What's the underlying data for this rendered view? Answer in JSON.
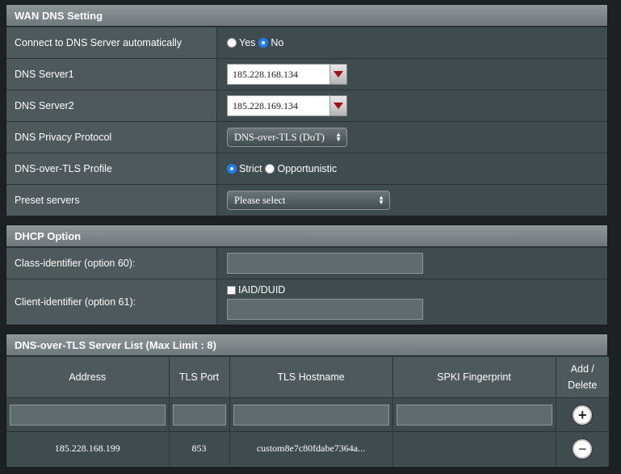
{
  "wan_dns": {
    "title": "WAN DNS Setting",
    "auto_label": "Connect to DNS Server automatically",
    "auto_options": [
      "Yes",
      "No"
    ],
    "auto_selected": "No",
    "dns1_label": "DNS Server1",
    "dns1_value": "185.228.168.134",
    "dns2_label": "DNS Server2",
    "dns2_value": "185.228.169.134",
    "privacy_label": "DNS Privacy Protocol",
    "privacy_value": "DNS-over-TLS (DoT)",
    "profile_label": "DNS-over-TLS Profile",
    "profile_options": [
      "Strict",
      "Opportunistic"
    ],
    "profile_selected": "Strict",
    "preset_label": "Preset servers",
    "preset_value": "Please select"
  },
  "dhcp": {
    "title": "DHCP Option",
    "class_label": "Class-identifier (option 60):",
    "class_value": "",
    "client_label": "Client-identifier (option 61):",
    "iaid_label": "IAID/DUID",
    "client_value": ""
  },
  "dot_list": {
    "title": "DNS-over-TLS Server List (Max Limit : 8)",
    "columns": [
      "Address",
      "TLS Port",
      "TLS Hostname",
      "SPKI Fingerprint",
      "Add / Delete"
    ],
    "rows": [
      {
        "address": "185.228.168.199",
        "port": "853",
        "hostname": "custom8e7c80fdabe7364a...",
        "fingerprint": ""
      }
    ]
  },
  "colors": {
    "accent": "#1f7cf2",
    "header_bg": "#7e878a",
    "panel_bg": "#4d595d"
  },
  "icons": {
    "add": "plus-circle-icon",
    "delete": "minus-circle-icon",
    "dropdown": "triangle-down-icon"
  }
}
